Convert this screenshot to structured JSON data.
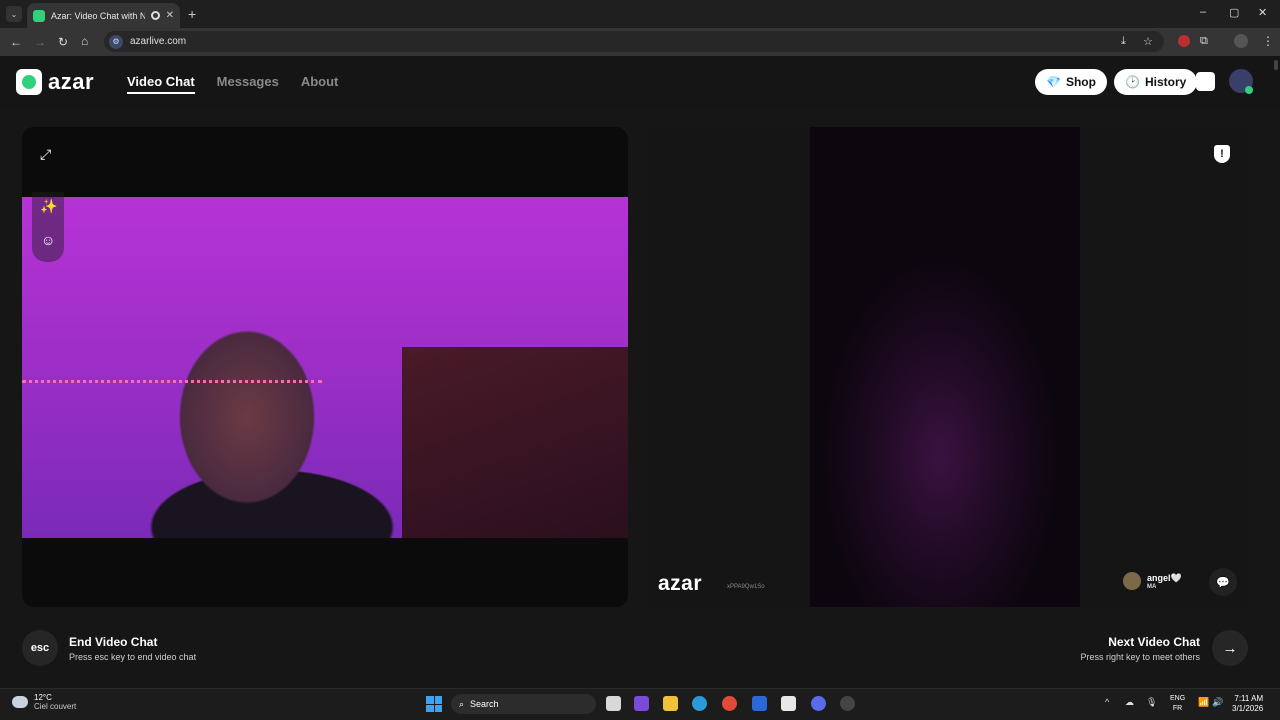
{
  "browser": {
    "tab_title": "Azar: Video Chat with New",
    "close_glyph": "✕",
    "new_tab_glyph": "+",
    "tab_list_glyph": "⌄",
    "url": "azarlive.com",
    "window_controls": [
      "–",
      "▢",
      "✕"
    ],
    "nav": {
      "back": "←",
      "forward": "→",
      "reload": "↻",
      "home": "⌂"
    },
    "toolbar_icons": [
      "⤓",
      "☆",
      "⧉"
    ],
    "menu_glyph": "⋮"
  },
  "site": {
    "logo_text": "azar",
    "nav": [
      {
        "label": "Video Chat",
        "active": true
      },
      {
        "label": "Messages",
        "active": false
      },
      {
        "label": "About",
        "active": false
      }
    ],
    "shop_label": "Shop",
    "history_label": "History",
    "shop_icon": "💎",
    "history_icon": "🕑"
  },
  "video": {
    "watermark": "azar",
    "watermark_id": "xPPA9Qw1So",
    "report_glyph": "!",
    "expand_glyph": "⤢",
    "magic_glyph": "✨",
    "face_glyph": "☺",
    "peer": {
      "name": "angel🤍",
      "country": "MA"
    },
    "chat_glyph": "💬"
  },
  "actions": {
    "end_key": "esc",
    "end_title": "End Video Chat",
    "end_hint": "Press esc key to end video chat",
    "next_title": "Next Video Chat",
    "next_hint": "Press right key to meet others",
    "next_glyph": "→"
  },
  "taskbar": {
    "temperature": "12°C",
    "weather": "Ciel couvert",
    "search": "Search",
    "search_glyph": "⌕",
    "lang_top": "ENG",
    "lang_bottom": "FR",
    "time": "7:11 AM",
    "date": "3/1/2026",
    "tray_glyphs": [
      "^",
      "☁",
      "🎙",
      "📶",
      "🔊"
    ]
  },
  "colors": {
    "accent": "#2fd27a",
    "background": "#161616"
  }
}
